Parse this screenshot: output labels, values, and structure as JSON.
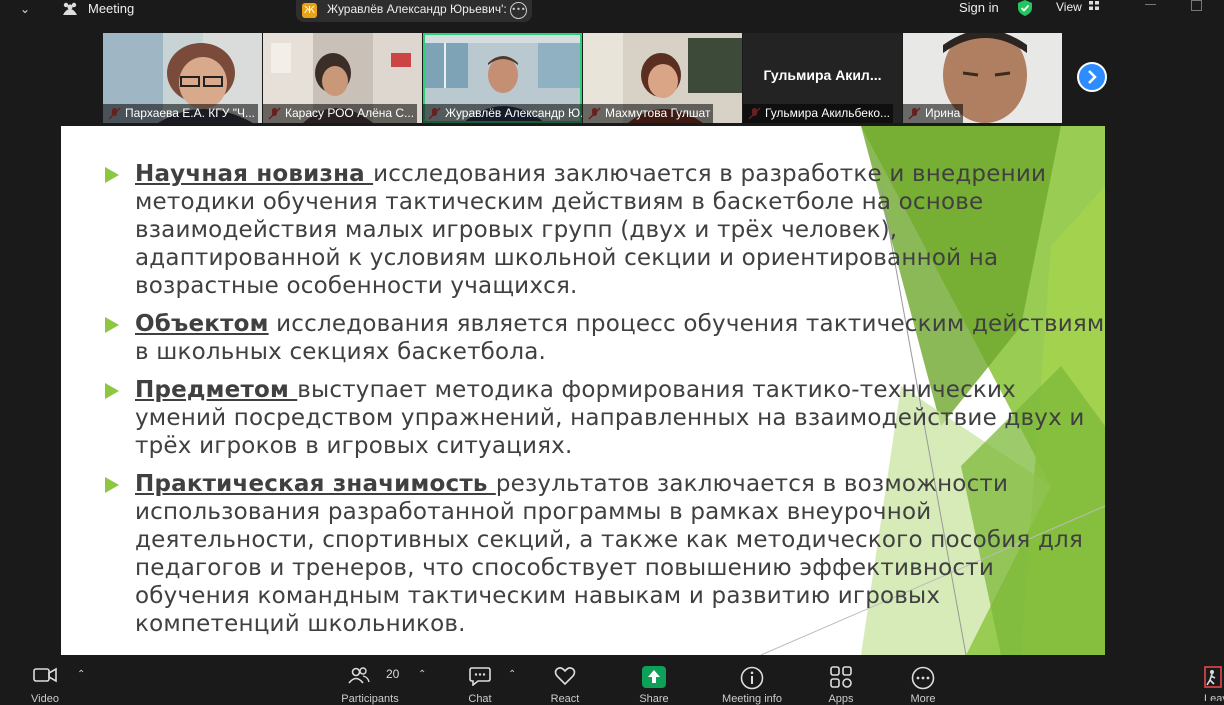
{
  "topbar": {
    "meeting_label": "Meeting",
    "speaker_initial": "Ж",
    "speaker_name": "Журавлёв Александр Юрьевич':",
    "signin_label": "Sign in",
    "view_label": "View"
  },
  "participants_strip": [
    {
      "name": "Пархаева Е.А. КГУ \"Ч...",
      "muted": true,
      "active": false
    },
    {
      "name": "Карасу РОО Алёна С...",
      "muted": true,
      "active": false
    },
    {
      "name": "Журавлёв Александр Ю...",
      "muted": true,
      "active": true
    },
    {
      "name": "Махмутова Гулшат",
      "muted": true,
      "active": false
    },
    {
      "name": "Гульмира Акильбеко...",
      "display_name": "Гульмира  Акил...",
      "muted": true,
      "active": false
    },
    {
      "name": "Ирина",
      "muted": true,
      "active": false
    }
  ],
  "slide": {
    "bullets": [
      {
        "term": "Научная новизна ",
        "lines": [
          "исследования заключается в разработке и внедрении",
          "методики обучения тактическим действиям в баскетболе на основе",
          "взаимодействия малых игровых групп (двух и трёх человек),",
          "адаптированной к условиям школьной секции и ориентированной на",
          "возрастные особенности учащихся."
        ]
      },
      {
        "term": "Объектом",
        "lines": [
          " исследования является процесс обучения тактическим действиям",
          "в школьных секциях баскетбола."
        ]
      },
      {
        "term": "Предметом ",
        "lines": [
          "выступает методика формирования тактико-технических",
          "умений посредством упражнений, направленных на взаимодействие двух и",
          "трёх игроков в игровых ситуациях."
        ]
      },
      {
        "term": "Практическая значимость ",
        "lines": [
          "результатов заключается в возможности",
          "использования разработанной программы в рамках внеурочной",
          "деятельности, спортивных секций, а также как методического пособия для",
          "педагогов и тренеров, что способствует повышению эффективности",
          "обучения командным тактическим навыкам и развитию игровых",
          "компетенций школьников."
        ]
      }
    ]
  },
  "toolbar": {
    "video_label": "Video",
    "participants_label": "Participants",
    "participants_count": "20",
    "chat_label": "Chat",
    "react_label": "React",
    "share_label": "Share",
    "meeting_info_label": "Meeting info",
    "apps_label": "Apps",
    "more_label": "More",
    "leave_label": "Leave"
  },
  "colors": {
    "slide_accent_green": "#8dc63f",
    "active_speaker_border": "#2fd07a",
    "share_green": "#0e9f59",
    "next_button_blue": "#2d8cff",
    "security_shield": "#22c55e"
  }
}
